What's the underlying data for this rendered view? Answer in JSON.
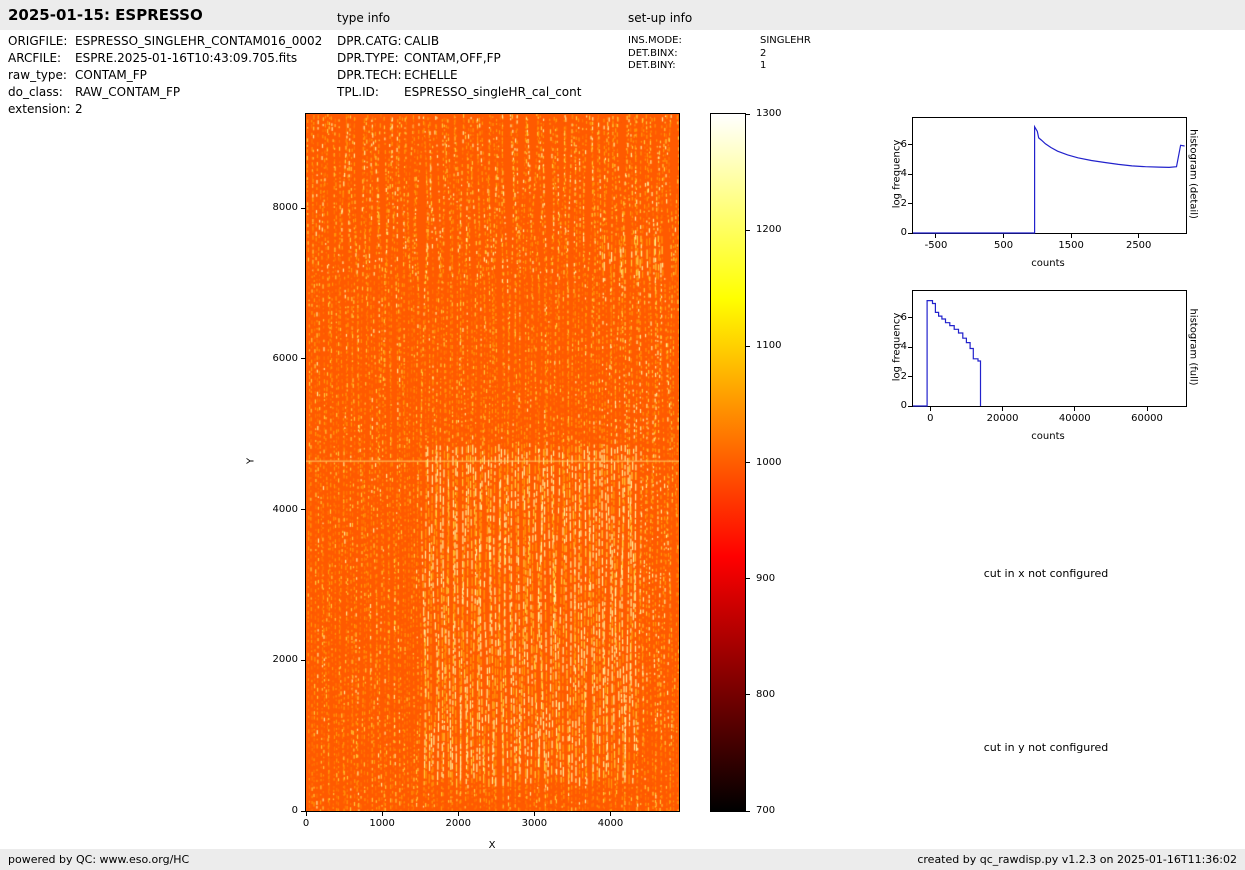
{
  "header": {
    "title": "2025-01-15: ESPRESSO",
    "type_info_label": "type info",
    "setup_info_label": "set-up info"
  },
  "file_info": {
    "rows": [
      {
        "label": "ORIGFILE:",
        "value": "ESPRESSO_SINGLEHR_CONTAM016_0002"
      },
      {
        "label": "ARCFILE:",
        "value": "ESPRE.2025-01-16T10:43:09.705.fits"
      },
      {
        "label": "raw_type:",
        "value": "CONTAM_FP"
      },
      {
        "label": "do_class:",
        "value": "RAW_CONTAM_FP"
      },
      {
        "label": "extension:",
        "value": "2"
      }
    ]
  },
  "type_info": {
    "rows": [
      {
        "label": "DPR.CATG:",
        "value": "CALIB"
      },
      {
        "label": "DPR.TYPE:",
        "value": "CONTAM,OFF,FP"
      },
      {
        "label": "DPR.TECH:",
        "value": "ECHELLE"
      },
      {
        "label": "TPL.ID:",
        "value": "ESPRESSO_singleHR_cal_cont"
      }
    ]
  },
  "setup_info": {
    "rows": [
      {
        "label": "INS.MODE:",
        "value": "SINGLEHR"
      },
      {
        "label": "DET.BINX:",
        "value": "2"
      },
      {
        "label": "DET.BINY:",
        "value": "1"
      }
    ]
  },
  "messages": {
    "cut_x": "cut in x not configured",
    "cut_y": "cut in y not configured"
  },
  "footer": {
    "left": "powered by QC: www.eso.org/HC",
    "right": "created by qc_rawdisp.py v1.2.3 on 2025-01-16T11:36:02"
  },
  "colors": {
    "bar_bg": "#ececec",
    "page_bg": "#ffffff",
    "hist_line": "#2222cc",
    "image_background_orange": "#ff5a00"
  },
  "chart_data": [
    {
      "id": "raw_image",
      "type": "heatmap",
      "xlabel": "X",
      "ylabel": "Y",
      "xlim": [
        0,
        4900
      ],
      "ylim": [
        0,
        9250
      ],
      "xticks": [
        0,
        1000,
        2000,
        3000,
        4000
      ],
      "yticks": [
        0,
        2000,
        4000,
        6000,
        8000
      ],
      "colormap": "hot",
      "value_range": [
        700,
        1300
      ],
      "background_counts": 1000,
      "bright_line_y": 4650,
      "description": "Raw CONTAM_FP echelle frame: uniform orange background near 1000 counts, dense vertical wavy echelle-order stripes of brighter yellow dots (1100-1300 counts), brighter streaks in lower-middle region, and a thin bright horizontal feature near Y=4650."
    },
    {
      "id": "colorbar",
      "type": "colorbar",
      "orientation": "vertical",
      "colormap": "hot",
      "ticks": [
        700,
        800,
        900,
        1000,
        1100,
        1200,
        1300
      ],
      "gradient_stops": [
        [
          0.0,
          "#000000"
        ],
        [
          0.1,
          "#460000"
        ],
        [
          0.2,
          "#8c0000"
        ],
        [
          0.3,
          "#d10000"
        ],
        [
          0.365,
          "#ff0000"
        ],
        [
          0.5,
          "#ff5d00"
        ],
        [
          0.6,
          "#ffa200"
        ],
        [
          0.735,
          "#ffff00"
        ],
        [
          0.85,
          "#ffff6e"
        ],
        [
          1.0,
          "#ffffff"
        ]
      ]
    },
    {
      "id": "histogram_detail",
      "type": "line",
      "side_label": "histogram (detail)",
      "xlabel": "counts",
      "ylabel": "log frequency",
      "color": "#2222cc",
      "xlim": [
        -840,
        3200
      ],
      "ylim": [
        0,
        7.8
      ],
      "xticks": [
        -500,
        500,
        1500,
        2500
      ],
      "yticks": [
        0,
        2,
        4,
        6
      ],
      "points": [
        [
          -840,
          0
        ],
        [
          960,
          0
        ],
        [
          960,
          7.2
        ],
        [
          1000,
          6.9
        ],
        [
          1020,
          6.45
        ],
        [
          1060,
          6.3
        ],
        [
          1120,
          6.05
        ],
        [
          1200,
          5.8
        ],
        [
          1300,
          5.55
        ],
        [
          1450,
          5.3
        ],
        [
          1600,
          5.1
        ],
        [
          1800,
          4.92
        ],
        [
          2000,
          4.78
        ],
        [
          2200,
          4.65
        ],
        [
          2400,
          4.55
        ],
        [
          2600,
          4.5
        ],
        [
          2800,
          4.47
        ],
        [
          2950,
          4.45
        ],
        [
          3060,
          4.5
        ],
        [
          3120,
          5.95
        ],
        [
          3180,
          5.9
        ]
      ]
    },
    {
      "id": "histogram_full",
      "type": "line",
      "side_label": "histogram (full)",
      "xlabel": "counts",
      "ylabel": "log frequency",
      "color": "#2222cc",
      "xlim": [
        -4800,
        70800
      ],
      "ylim": [
        0,
        7.8
      ],
      "xticks": [
        0,
        20000,
        40000,
        60000
      ],
      "yticks": [
        0,
        2,
        4,
        6
      ],
      "points": [
        [
          -4800,
          0
        ],
        [
          -900,
          0
        ],
        [
          -900,
          7.15
        ],
        [
          600,
          7.15
        ],
        [
          600,
          6.95
        ],
        [
          1400,
          6.95
        ],
        [
          1400,
          6.35
        ],
        [
          2300,
          6.35
        ],
        [
          2300,
          6.1
        ],
        [
          3200,
          6.1
        ],
        [
          3200,
          5.9
        ],
        [
          4200,
          5.9
        ],
        [
          4200,
          5.65
        ],
        [
          5400,
          5.65
        ],
        [
          5400,
          5.45
        ],
        [
          6600,
          5.45
        ],
        [
          6600,
          5.2
        ],
        [
          7800,
          5.2
        ],
        [
          7800,
          4.95
        ],
        [
          9000,
          4.95
        ],
        [
          9000,
          4.6
        ],
        [
          10000,
          4.6
        ],
        [
          10000,
          4.3
        ],
        [
          11000,
          4.3
        ],
        [
          11000,
          3.9
        ],
        [
          11900,
          3.9
        ],
        [
          11900,
          3.2
        ],
        [
          13200,
          3.2
        ],
        [
          13200,
          3.05
        ],
        [
          13900,
          3.05
        ],
        [
          13900,
          0
        ]
      ]
    }
  ]
}
